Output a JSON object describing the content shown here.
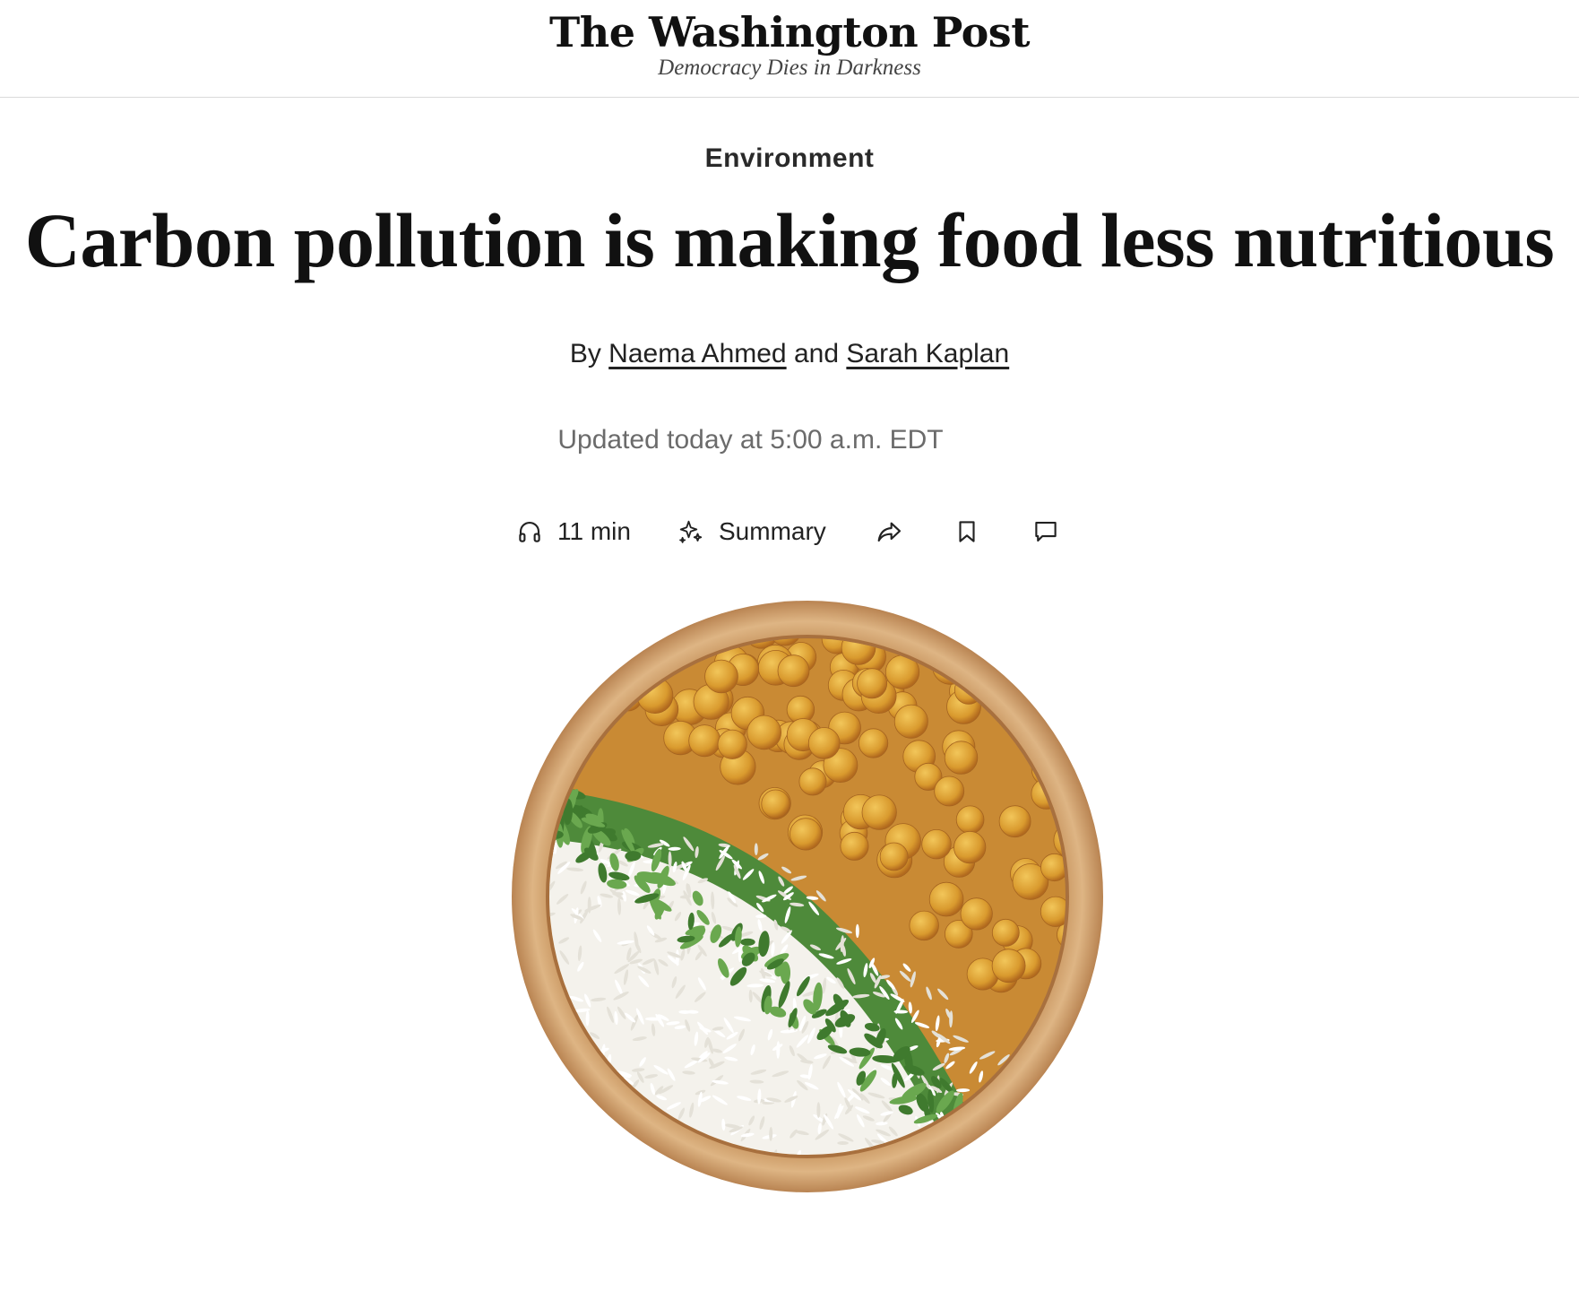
{
  "masthead": {
    "logo": "The Washington Post",
    "tagline": "Democracy Dies in Darkness"
  },
  "article": {
    "section": "Environment",
    "headline": "Carbon pollution is making food less nutritious",
    "byline": {
      "prefix": "By",
      "author1": "Naema Ahmed",
      "conjunction": "and",
      "author2": "Sarah Kaplan"
    },
    "updated": "Updated today at 5:00 a.m. EDT"
  },
  "toolbar": {
    "listen": {
      "icon": "headphones-icon",
      "label": "11 min"
    },
    "summary": {
      "icon": "sparkle-icon",
      "label": "Summary"
    },
    "share": {
      "icon": "share-icon"
    },
    "save": {
      "icon": "bookmark-icon"
    },
    "comments": {
      "icon": "comment-icon"
    }
  },
  "hero_image": {
    "subject": "bowl-of-chickpeas-rice-and-herbs",
    "colors": {
      "bowl": "#d2a574",
      "rice": "#f7f6f2",
      "chickpea": "#e0a83c",
      "herbs": "#4e8a3a"
    }
  }
}
